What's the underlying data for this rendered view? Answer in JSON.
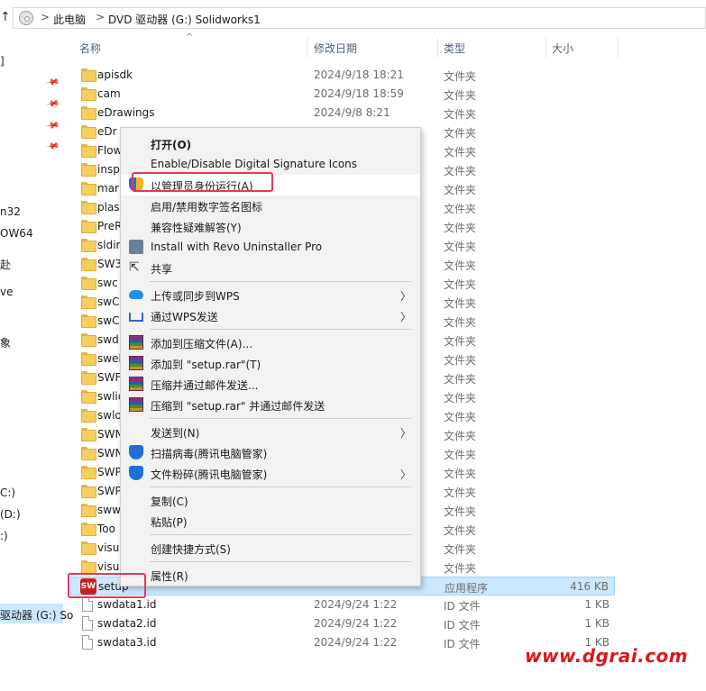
{
  "address_bar": {
    "up_icon": "up-arrow",
    "location_icon": "this-pc-icon",
    "crumbs": [
      "此电脑",
      "DVD 驱动器 (G:) Solidworks1"
    ],
    "separator": ">"
  },
  "nav_pane": {
    "items": [
      {
        "label": "]",
        "pinned": false
      },
      {
        "label": "",
        "pinned": true
      },
      {
        "label": "",
        "pinned": true
      },
      {
        "label": "",
        "pinned": true
      },
      {
        "label": "",
        "pinned": true
      },
      {
        "label": "n32",
        "pinned": false
      },
      {
        "label": "OW64",
        "pinned": false
      },
      {
        "label": "赴",
        "pinned": false
      },
      {
        "label": "ve",
        "pinned": false
      },
      {
        "label": "象",
        "pinned": false
      },
      {
        "label": "C:)",
        "pinned": false
      },
      {
        "label": "(D:)",
        "pinned": false
      },
      {
        "label": ":)",
        "pinned": false
      },
      {
        "label": "驱动器 (G:) So",
        "pinned": false
      }
    ]
  },
  "columns": {
    "name": "名称",
    "date": "修改日期",
    "type": "类型",
    "size": "大小"
  },
  "files": [
    {
      "name": "apisdk",
      "date": "2024/9/18 18:21",
      "type": "文件夹",
      "size": "",
      "icon": "folder-icon"
    },
    {
      "name": "cam",
      "date": "2024/9/18 18:59",
      "type": "文件夹",
      "size": "",
      "icon": "folder-icon"
    },
    {
      "name": "eDrawings",
      "date": "2024/9/8 8:21",
      "type": "文件夹",
      "size": "",
      "icon": "folder-icon"
    },
    {
      "name": "eDr",
      "date": "",
      "type": "文件夹",
      "size": "",
      "icon": "folder-icon"
    },
    {
      "name": "Flow",
      "date": "",
      "type": "文件夹",
      "size": "",
      "icon": "folder-icon"
    },
    {
      "name": "insp",
      "date": "",
      "type": "文件夹",
      "size": "",
      "icon": "folder-icon"
    },
    {
      "name": "mar",
      "date": "",
      "type": "文件夹",
      "size": "",
      "icon": "folder-icon"
    },
    {
      "name": "plas",
      "date": "",
      "type": "文件夹",
      "size": "",
      "icon": "folder-icon"
    },
    {
      "name": "PreR",
      "date": "",
      "type": "文件夹",
      "size": "",
      "icon": "folder-icon"
    },
    {
      "name": "sldir",
      "date": "",
      "type": "文件夹",
      "size": "",
      "icon": "folder-icon"
    },
    {
      "name": "SW3",
      "date": "",
      "type": "文件夹",
      "size": "",
      "icon": "folder-icon"
    },
    {
      "name": "swc",
      "date": "",
      "type": "文件夹",
      "size": "",
      "icon": "folder-icon"
    },
    {
      "name": "swC",
      "date": "",
      "type": "文件夹",
      "size": "",
      "icon": "folder-icon"
    },
    {
      "name": "swC",
      "date": "",
      "type": "文件夹",
      "size": "",
      "icon": "folder-icon"
    },
    {
      "name": "swd",
      "date": "",
      "type": "文件夹",
      "size": "",
      "icon": "folder-icon"
    },
    {
      "name": "swel",
      "date": "",
      "type": "文件夹",
      "size": "",
      "icon": "folder-icon"
    },
    {
      "name": "SWF",
      "date": "",
      "type": "文件夹",
      "size": "",
      "icon": "folder-icon"
    },
    {
      "name": "swlic",
      "date": "",
      "type": "文件夹",
      "size": "",
      "icon": "folder-icon"
    },
    {
      "name": "swlo",
      "date": "",
      "type": "文件夹",
      "size": "",
      "icon": "folder-icon"
    },
    {
      "name": "SWN",
      "date": "",
      "type": "文件夹",
      "size": "",
      "icon": "folder-icon"
    },
    {
      "name": "SWN",
      "date": "",
      "type": "文件夹",
      "size": "",
      "icon": "folder-icon"
    },
    {
      "name": "SWP",
      "date": "",
      "type": "文件夹",
      "size": "",
      "icon": "folder-icon"
    },
    {
      "name": "SWP",
      "date": "",
      "type": "文件夹",
      "size": "",
      "icon": "folder-icon"
    },
    {
      "name": "sww",
      "date": "",
      "type": "文件夹",
      "size": "",
      "icon": "folder-icon"
    },
    {
      "name": "Too",
      "date": "",
      "type": "文件夹",
      "size": "",
      "icon": "folder-icon"
    },
    {
      "name": "visu",
      "date": "",
      "type": "文件夹",
      "size": "",
      "icon": "folder-icon"
    },
    {
      "name": "visu",
      "date": "",
      "type": "文件夹",
      "size": "",
      "icon": "folder-icon"
    },
    {
      "name": "setup",
      "date": "",
      "type": "应用程序",
      "size": "416 KB",
      "icon": "solidworks-app-icon",
      "selected": true
    },
    {
      "name": "swdata1.id",
      "date": "2024/9/24 1:22",
      "type": "ID 文件",
      "size": "1 KB",
      "icon": "file-icon"
    },
    {
      "name": "swdata2.id",
      "date": "2024/9/24 1:22",
      "type": "ID 文件",
      "size": "1 KB",
      "icon": "file-icon"
    },
    {
      "name": "swdata3.id",
      "date": "2024/9/24 1:22",
      "type": "ID 文件",
      "size": "1 KB",
      "icon": "file-icon"
    }
  ],
  "context_menu": {
    "groups": [
      [
        {
          "label": "打开(O)",
          "bold": true,
          "icon": "",
          "submenu": false
        },
        {
          "label": "Enable/Disable Digital Signature Icons",
          "icon": "",
          "submenu": false
        },
        {
          "label": "以管理员身份运行(A)",
          "icon": "uac-shield-icon",
          "submenu": false,
          "highlighted": true
        },
        {
          "label": "启用/禁用数字签名图标",
          "icon": "",
          "submenu": false
        },
        {
          "label": "兼容性疑难解答(Y)",
          "icon": "",
          "submenu": false
        },
        {
          "label": "Install with Revo Uninstaller Pro",
          "icon": "revo-uninstaller-icon",
          "submenu": false
        },
        {
          "label": "共享",
          "icon": "share-icon",
          "submenu": false
        }
      ],
      [
        {
          "label": "上传或同步到WPS",
          "icon": "wps-cloud-icon",
          "submenu": true
        },
        {
          "label": "通过WPS发送",
          "icon": "wps-send-icon",
          "submenu": true
        }
      ],
      [
        {
          "label": "添加到压缩文件(A)...",
          "icon": "winrar-icon",
          "submenu": false
        },
        {
          "label": "添加到 \"setup.rar\"(T)",
          "icon": "winrar-icon",
          "submenu": false
        },
        {
          "label": "压缩并通过邮件发送...",
          "icon": "winrar-icon",
          "submenu": false
        },
        {
          "label": "压缩到 \"setup.rar\" 并通过邮件发送",
          "icon": "winrar-icon",
          "submenu": false
        }
      ],
      [
        {
          "label": "发送到(N)",
          "icon": "",
          "submenu": true
        },
        {
          "label": "扫描病毒(腾讯电脑管家)",
          "icon": "tencent-pc-manager-icon",
          "submenu": false
        },
        {
          "label": "文件粉碎(腾讯电脑管家)",
          "icon": "tencent-pc-manager-icon",
          "submenu": true
        }
      ],
      [
        {
          "label": "复制(C)",
          "icon": "",
          "submenu": false
        },
        {
          "label": "粘贴(P)",
          "icon": "",
          "submenu": false
        }
      ],
      [
        {
          "label": "创建快捷方式(S)",
          "icon": "",
          "submenu": false
        }
      ],
      [
        {
          "label": "属性(R)",
          "icon": "",
          "submenu": false
        }
      ]
    ]
  },
  "watermark": "www.dgrai.com",
  "colors": {
    "selection": "#cce8ff",
    "annotation_box": "#e23a55",
    "watermark": "#d9181e",
    "folder": "#f7ce5c"
  }
}
